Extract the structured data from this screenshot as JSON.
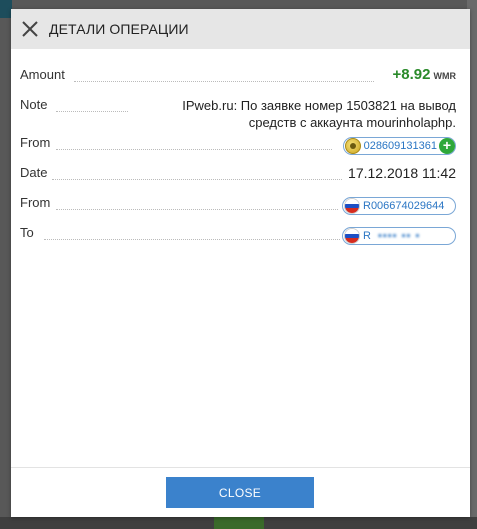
{
  "dialog": {
    "title": "ДЕТАЛИ ОПЕРАЦИИ",
    "close_button": "CLOSE"
  },
  "details": {
    "amount_label": "Amount",
    "amount_value": "+8.92",
    "amount_currency": "WMR",
    "note_label": "Note",
    "note_value": "IPweb.ru: По заявке номер 1503821 на вывод средств с аккаунта mourinholaphp.",
    "from1_label": "From",
    "from1_id": "028609131361",
    "date_label": "Date",
    "date_value": "17.12.2018 11:42",
    "from2_label": "From",
    "from2_id": "R006674029644",
    "to_label": "To",
    "to_id": "R"
  },
  "colors": {
    "amount": "#2a8a2a",
    "accent": "#3b82cc",
    "link": "#2b76c4"
  },
  "icons": {
    "close": "close-x-icon",
    "wm_coin": "webmoney-coin-icon",
    "add": "plus-circle-icon",
    "flag": "russia-flag-icon"
  }
}
